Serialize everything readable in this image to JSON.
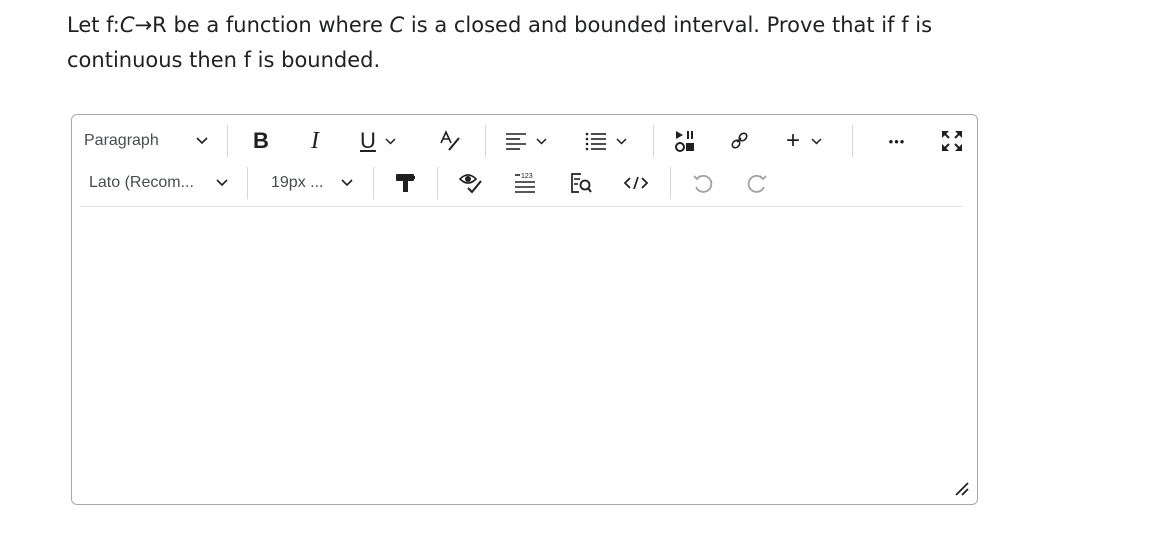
{
  "question": {
    "line1_a": "Let f:",
    "line1_C": "C",
    "line1_arrow": "→",
    "line1_b": "R be a function where ",
    "line1_C2": "C",
    "line1_c": " is a closed and bounded interval. Prove that if f is",
    "line2": "continuous then f is bounded."
  },
  "toolbar": {
    "paragraph_label": "Paragraph",
    "font_label": "Lato (Recom...",
    "size_label": "19px ...",
    "bold_label": "B",
    "italic_label": "I",
    "underline_label": "U",
    "plus_label": "+",
    "more_label": "•••"
  },
  "editor": {
    "content": ""
  },
  "colors": {
    "border": "#a7a9ad",
    "icon": "#202020"
  }
}
